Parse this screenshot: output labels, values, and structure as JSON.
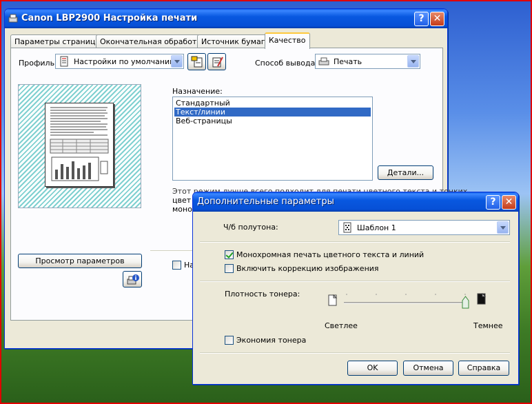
{
  "main_window": {
    "title": "Canon LBP2900 Настройка печати",
    "help": "?",
    "close": "✕",
    "tabs": [
      {
        "label": "Параметры страницы"
      },
      {
        "label": "Окончательная обработка"
      },
      {
        "label": "Источник бумаги"
      },
      {
        "label": "Качество"
      }
    ],
    "active_tab": 3,
    "profile": {
      "label": "Профиль:",
      "value": "Настройки по умолчанию"
    },
    "output": {
      "label": "Способ вывода:",
      "value": "Печать"
    },
    "purpose": {
      "label": "Назначение:",
      "options": [
        "Стандартный",
        "Текст/линии",
        "Веб-страницы"
      ],
      "selected": 1
    },
    "details_button": "Детали...",
    "description_text": "Этот режим лучше всего подходит для печати цветного текста и тонких",
    "description_text2": "цвет",
    "description_text3": "моно",
    "preview_button": "Просмотр параметров",
    "partial_checkbox_label": "На"
  },
  "dialog": {
    "title": "Дополнительные параметры",
    "help": "?",
    "close": "✕",
    "halftone": {
      "label": "Ч/б полутона:",
      "value": "Шаблон 1"
    },
    "mono_print": {
      "label": "Монохромная печать цветного текста и линий",
      "checked": true
    },
    "image_correction": {
      "label": "Включить коррекцию изображения",
      "checked": false
    },
    "toner_density": {
      "label": "Плотность тонера:",
      "lighter": "Светлее",
      "darker": "Темнее",
      "level": 1.0
    },
    "toner_save": {
      "label": "Экономия тонера",
      "checked": false
    },
    "ok": "OK",
    "cancel": "Отмена",
    "help_button": "Справка"
  }
}
